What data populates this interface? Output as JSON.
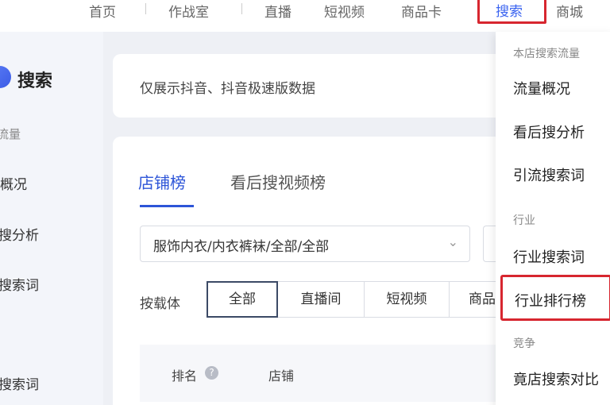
{
  "topnav": {
    "items": [
      "首页",
      "作战室",
      "直播",
      "短视频",
      "商品卡",
      "搜索",
      "商城"
    ],
    "active": "搜索"
  },
  "sidebar": {
    "title": "搜索",
    "group": "流量",
    "items": [
      "概况",
      "搜分析",
      "搜索词",
      "搜索词"
    ]
  },
  "notice": "仅展示抖音、抖音极速版数据",
  "tabs": [
    "店铺榜",
    "看后搜视频榜"
  ],
  "category_select": "服饰内衣/内衣裤袜/全部/全部",
  "carrier": {
    "label": "按载体",
    "options": [
      "全部",
      "直播间",
      "短视频",
      "商品"
    ],
    "selected": "全部"
  },
  "table": {
    "headers": [
      "排名",
      "店铺"
    ],
    "help_icon": "question-circle-icon"
  },
  "dropdown": {
    "groups": [
      {
        "title": "本店搜索流量",
        "items": [
          "流量概况",
          "看后搜分析",
          "引流搜索词"
        ]
      },
      {
        "title": "行业",
        "items": [
          "行业搜索词",
          "行业排行榜"
        ]
      },
      {
        "title": "竞争",
        "items": [
          "竟店搜索对比"
        ]
      }
    ],
    "highlighted": "行业排行榜"
  },
  "colors": {
    "accent": "#2d55d8",
    "highlight_box": "#d7262f",
    "background": "#eef0f5"
  }
}
